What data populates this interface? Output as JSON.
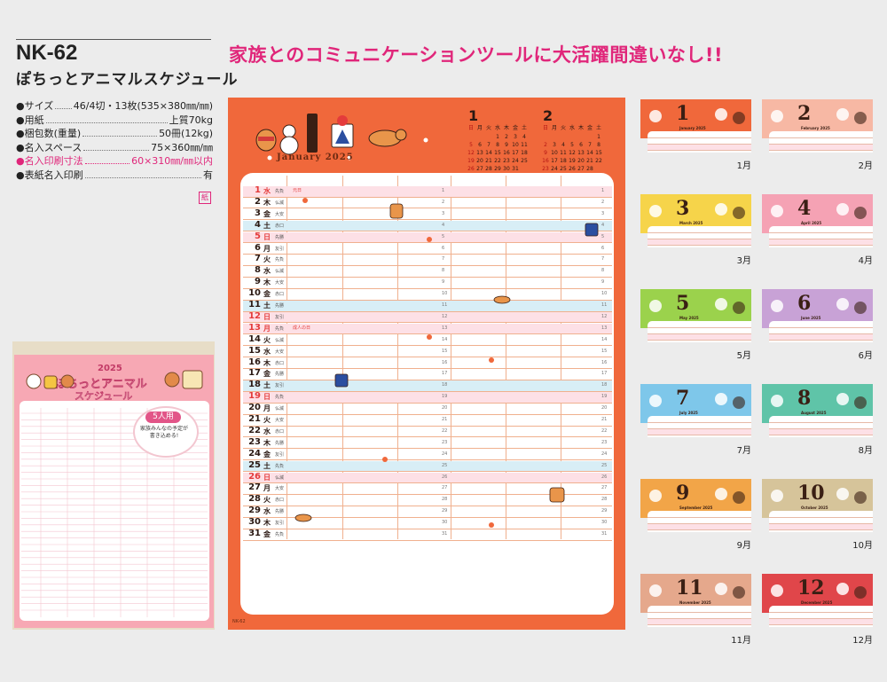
{
  "product": {
    "model": "NK-62",
    "name": "ぽちっとアニマルスケジュール",
    "paper_badge": "紙"
  },
  "specs": [
    {
      "label": "●サイズ",
      "value": "46/4切・13枚(535×380㎜/㎜)",
      "pink": false
    },
    {
      "label": "●用紙",
      "value": "上質70kg",
      "pink": false
    },
    {
      "label": "●梱包数(重量)",
      "value": "50冊(12kg)",
      "pink": false
    },
    {
      "label": "●名入スペース",
      "value": "75×360㎜/㎜",
      "pink": false
    },
    {
      "label": "●名入印刷寸法",
      "value": "60×310㎜/㎜以内",
      "pink": true
    },
    {
      "label": "●表紙名入印刷",
      "value": "有",
      "pink": false
    }
  ],
  "headline": "家族とのコミュニケーションツールに大活躍間違いなし!!",
  "cover": {
    "year": "2025",
    "title_1": "ぽちっとアニマル",
    "title_2": "スケジュール",
    "badge_label": "5人用",
    "badge_text": "家族みんなの予定が書き込める!"
  },
  "main_calendar": {
    "month_number": "1",
    "month_name": "January 2025",
    "footer": "NK-62",
    "mini_calendars": [
      {
        "month": "1",
        "weekdays": [
          "日",
          "月",
          "火",
          "水",
          "木",
          "金",
          "土"
        ],
        "weeks": [
          [
            "",
            "",
            "",
            "1",
            "2",
            "3",
            "4"
          ],
          [
            "5",
            "6",
            "7",
            "8",
            "9",
            "10",
            "11"
          ],
          [
            "12",
            "13",
            "14",
            "15",
            "16",
            "17",
            "18"
          ],
          [
            "19",
            "20",
            "21",
            "22",
            "23",
            "24",
            "25"
          ],
          [
            "26",
            "27",
            "28",
            "29",
            "30",
            "31",
            ""
          ]
        ]
      },
      {
        "month": "2",
        "weekdays": [
          "日",
          "月",
          "火",
          "水",
          "木",
          "金",
          "土"
        ],
        "weeks": [
          [
            "",
            "",
            "",
            "",
            "",
            "",
            "1"
          ],
          [
            "2",
            "3",
            "4",
            "5",
            "6",
            "7",
            "8"
          ],
          [
            "9",
            "10",
            "11",
            "12",
            "13",
            "14",
            "15"
          ],
          [
            "16",
            "17",
            "18",
            "19",
            "20",
            "21",
            "22"
          ],
          [
            "23",
            "24",
            "25",
            "26",
            "27",
            "28",
            ""
          ]
        ]
      }
    ],
    "days": [
      {
        "d": "1",
        "w": "水",
        "r": "先負",
        "h": "元日",
        "type": "sun"
      },
      {
        "d": "2",
        "w": "木",
        "r": "仏滅",
        "h": "",
        "type": ""
      },
      {
        "d": "3",
        "w": "金",
        "r": "大安",
        "h": "",
        "type": ""
      },
      {
        "d": "4",
        "w": "土",
        "r": "赤口",
        "h": "",
        "type": "sat"
      },
      {
        "d": "5",
        "w": "日",
        "r": "先勝",
        "h": "",
        "type": "sun"
      },
      {
        "d": "6",
        "w": "月",
        "r": "友引",
        "h": "",
        "type": ""
      },
      {
        "d": "7",
        "w": "火",
        "r": "先負",
        "h": "",
        "type": ""
      },
      {
        "d": "8",
        "w": "水",
        "r": "仏滅",
        "h": "",
        "type": ""
      },
      {
        "d": "9",
        "w": "木",
        "r": "大安",
        "h": "",
        "type": ""
      },
      {
        "d": "10",
        "w": "金",
        "r": "赤口",
        "h": "",
        "type": ""
      },
      {
        "d": "11",
        "w": "土",
        "r": "先勝",
        "h": "",
        "type": "sat"
      },
      {
        "d": "12",
        "w": "日",
        "r": "友引",
        "h": "",
        "type": "sun"
      },
      {
        "d": "13",
        "w": "月",
        "r": "先負",
        "h": "成人の日",
        "type": "sun"
      },
      {
        "d": "14",
        "w": "火",
        "r": "仏滅",
        "h": "",
        "type": ""
      },
      {
        "d": "15",
        "w": "水",
        "r": "大安",
        "h": "",
        "type": ""
      },
      {
        "d": "16",
        "w": "木",
        "r": "赤口",
        "h": "",
        "type": ""
      },
      {
        "d": "17",
        "w": "金",
        "r": "先勝",
        "h": "",
        "type": ""
      },
      {
        "d": "18",
        "w": "土",
        "r": "友引",
        "h": "",
        "type": "sat"
      },
      {
        "d": "19",
        "w": "日",
        "r": "先負",
        "h": "",
        "type": "sun"
      },
      {
        "d": "20",
        "w": "月",
        "r": "仏滅",
        "h": "",
        "type": ""
      },
      {
        "d": "21",
        "w": "火",
        "r": "大安",
        "h": "",
        "type": ""
      },
      {
        "d": "22",
        "w": "水",
        "r": "赤口",
        "h": "",
        "type": ""
      },
      {
        "d": "23",
        "w": "木",
        "r": "先勝",
        "h": "",
        "type": ""
      },
      {
        "d": "24",
        "w": "金",
        "r": "友引",
        "h": "",
        "type": ""
      },
      {
        "d": "25",
        "w": "土",
        "r": "先負",
        "h": "",
        "type": "sat"
      },
      {
        "d": "26",
        "w": "日",
        "r": "仏滅",
        "h": "",
        "type": "sun"
      },
      {
        "d": "27",
        "w": "月",
        "r": "大安",
        "h": "",
        "type": ""
      },
      {
        "d": "28",
        "w": "火",
        "r": "赤口",
        "h": "",
        "type": ""
      },
      {
        "d": "29",
        "w": "水",
        "r": "先勝",
        "h": "",
        "type": ""
      },
      {
        "d": "30",
        "w": "木",
        "r": "友引",
        "h": "",
        "type": ""
      },
      {
        "d": "31",
        "w": "金",
        "r": "先負",
        "h": "",
        "type": ""
      }
    ]
  },
  "months": [
    {
      "num": "1",
      "en": "January 2025",
      "label": "1月",
      "color": "#f0683b"
    },
    {
      "num": "2",
      "en": "February 2025",
      "label": "2月",
      "color": "#f7b8a4"
    },
    {
      "num": "3",
      "en": "March 2025",
      "label": "3月",
      "color": "#f6d44a"
    },
    {
      "num": "4",
      "en": "April 2025",
      "label": "4月",
      "color": "#f5a2b4"
    },
    {
      "num": "5",
      "en": "May 2025",
      "label": "5月",
      "color": "#9bd24c"
    },
    {
      "num": "6",
      "en": "June 2025",
      "label": "6月",
      "color": "#c8a2d6"
    },
    {
      "num": "7",
      "en": "July 2025",
      "label": "7月",
      "color": "#7ec7ea"
    },
    {
      "num": "8",
      "en": "August 2025",
      "label": "8月",
      "color": "#5fc4a8"
    },
    {
      "num": "9",
      "en": "September 2025",
      "label": "9月",
      "color": "#f2a548"
    },
    {
      "num": "10",
      "en": "October 2025",
      "label": "10月",
      "color": "#d6c49a"
    },
    {
      "num": "11",
      "en": "November 2025",
      "label": "11月",
      "color": "#e5a88c"
    },
    {
      "num": "12",
      "en": "December 2025",
      "label": "12月",
      "color": "#e0464a"
    }
  ]
}
